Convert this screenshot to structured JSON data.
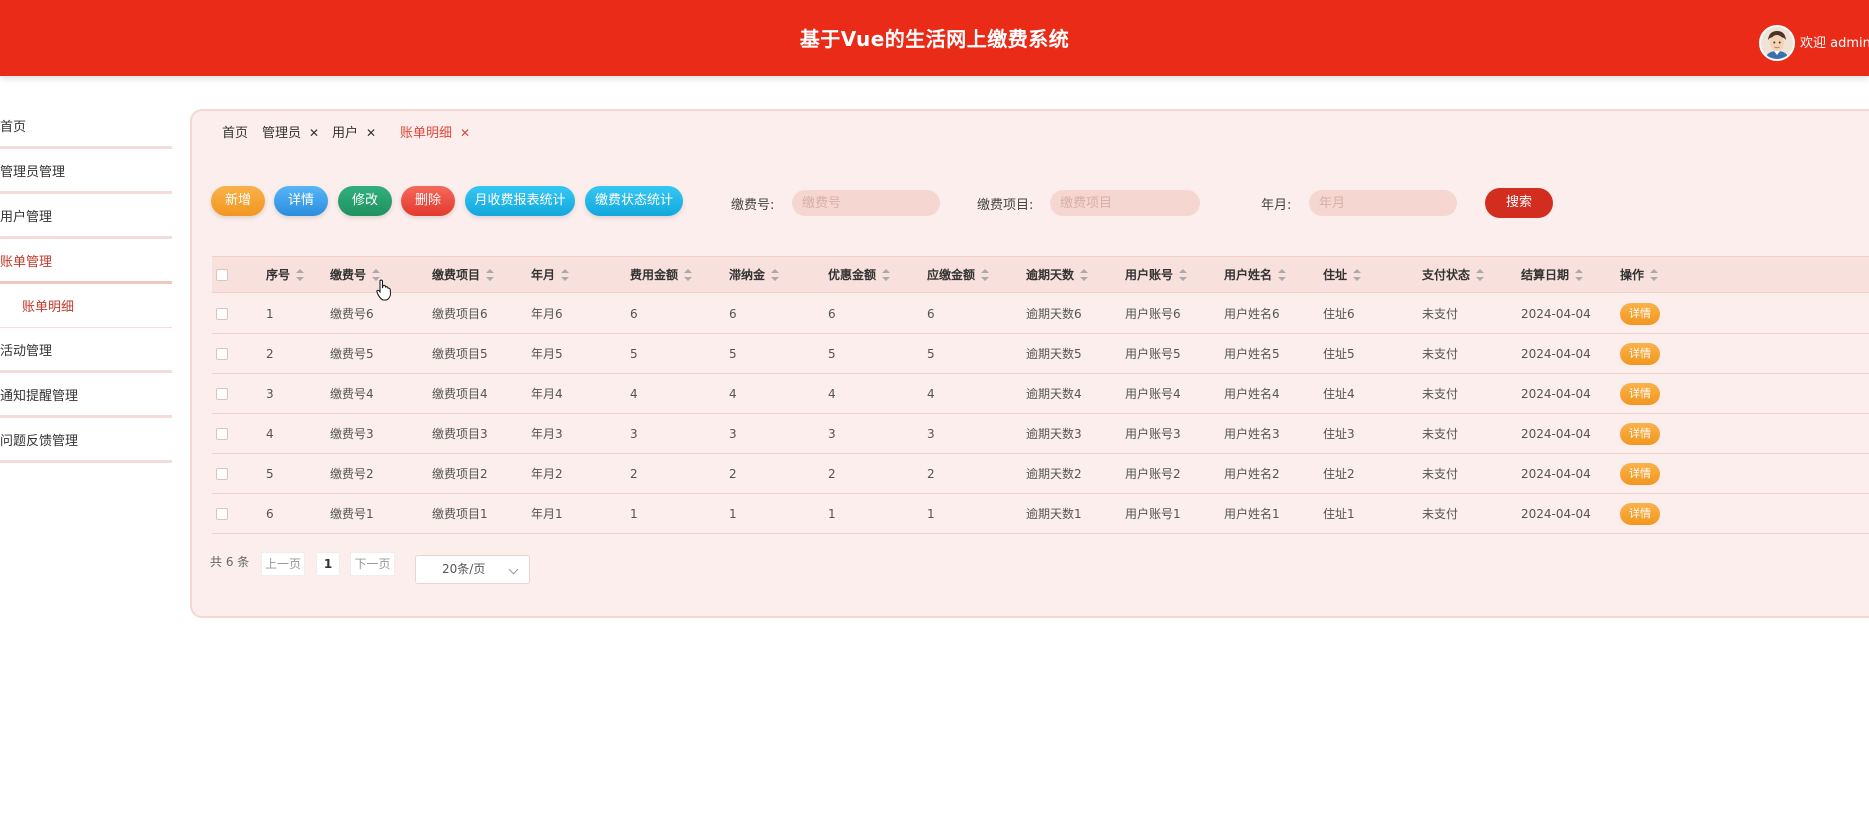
{
  "header": {
    "title": "基于Vue的生活网上缴费系统",
    "welcome": "欢迎 admin"
  },
  "sidebar": {
    "items": [
      {
        "label": "首页"
      },
      {
        "label": "管理员管理"
      },
      {
        "label": "用户管理"
      },
      {
        "label": "账单管理"
      },
      {
        "label": "活动管理"
      },
      {
        "label": "通知提醒管理"
      },
      {
        "label": "问题反馈管理"
      }
    ],
    "sub_item": "账单明细"
  },
  "breadcrumb": {
    "tabs": [
      {
        "label": "首页",
        "closable": false
      },
      {
        "label": "管理员",
        "closable": true
      },
      {
        "label": "用户",
        "closable": true
      },
      {
        "label": "账单明细",
        "closable": true
      }
    ],
    "close_glyph": "✕"
  },
  "toolbar": {
    "add": "新增",
    "detail": "详情",
    "edit": "修改",
    "delete": "删除",
    "monthly_stats": "月收费报表统计",
    "status_stats": "缴费状态统计"
  },
  "filters": {
    "pay_no_label": "缴费号:",
    "pay_no_placeholder": "缴费号",
    "item_label": "缴费项目:",
    "item_placeholder": "缴费项目",
    "month_label": "年月:",
    "month_placeholder": "年月",
    "search": "搜索"
  },
  "table": {
    "headers": [
      "序号",
      "缴费号",
      "缴费项目",
      "年月",
      "费用金额",
      "滞纳金",
      "优惠金额",
      "应缴金额",
      "逾期天数",
      "用户账号",
      "用户姓名",
      "住址",
      "支付状态",
      "结算日期",
      "操作"
    ],
    "rows": [
      [
        "1",
        "缴费号6",
        "缴费项目6",
        "年月6",
        "6",
        "6",
        "6",
        "6",
        "逾期天数6",
        "用户账号6",
        "用户姓名6",
        "住址6",
        "未支付",
        "2024-04-04",
        "详情"
      ],
      [
        "2",
        "缴费号5",
        "缴费项目5",
        "年月5",
        "5",
        "5",
        "5",
        "5",
        "逾期天数5",
        "用户账号5",
        "用户姓名5",
        "住址5",
        "未支付",
        "2024-04-04",
        "详情"
      ],
      [
        "3",
        "缴费号4",
        "缴费项目4",
        "年月4",
        "4",
        "4",
        "4",
        "4",
        "逾期天数4",
        "用户账号4",
        "用户姓名4",
        "住址4",
        "未支付",
        "2024-04-04",
        "详情"
      ],
      [
        "4",
        "缴费号3",
        "缴费项目3",
        "年月3",
        "3",
        "3",
        "3",
        "3",
        "逾期天数3",
        "用户账号3",
        "用户姓名3",
        "住址3",
        "未支付",
        "2024-04-04",
        "详情"
      ],
      [
        "5",
        "缴费号2",
        "缴费项目2",
        "年月2",
        "2",
        "2",
        "2",
        "2",
        "逾期天数2",
        "用户账号2",
        "用户姓名2",
        "住址2",
        "未支付",
        "2024-04-04",
        "详情"
      ],
      [
        "6",
        "缴费号1",
        "缴费项目1",
        "年月1",
        "1",
        "1",
        "1",
        "1",
        "逾期天数1",
        "用户账号1",
        "用户姓名1",
        "住址1",
        "未支付",
        "2024-04-04",
        "详情"
      ]
    ]
  },
  "pagination": {
    "total": "共 6 条",
    "prev": "上一页",
    "page": "1",
    "next": "下一页",
    "page_size": "20条/页"
  },
  "colors": {
    "header_bg": "#e92b18",
    "accent": "#c0392b",
    "panel_bg": "#fbeeec"
  }
}
